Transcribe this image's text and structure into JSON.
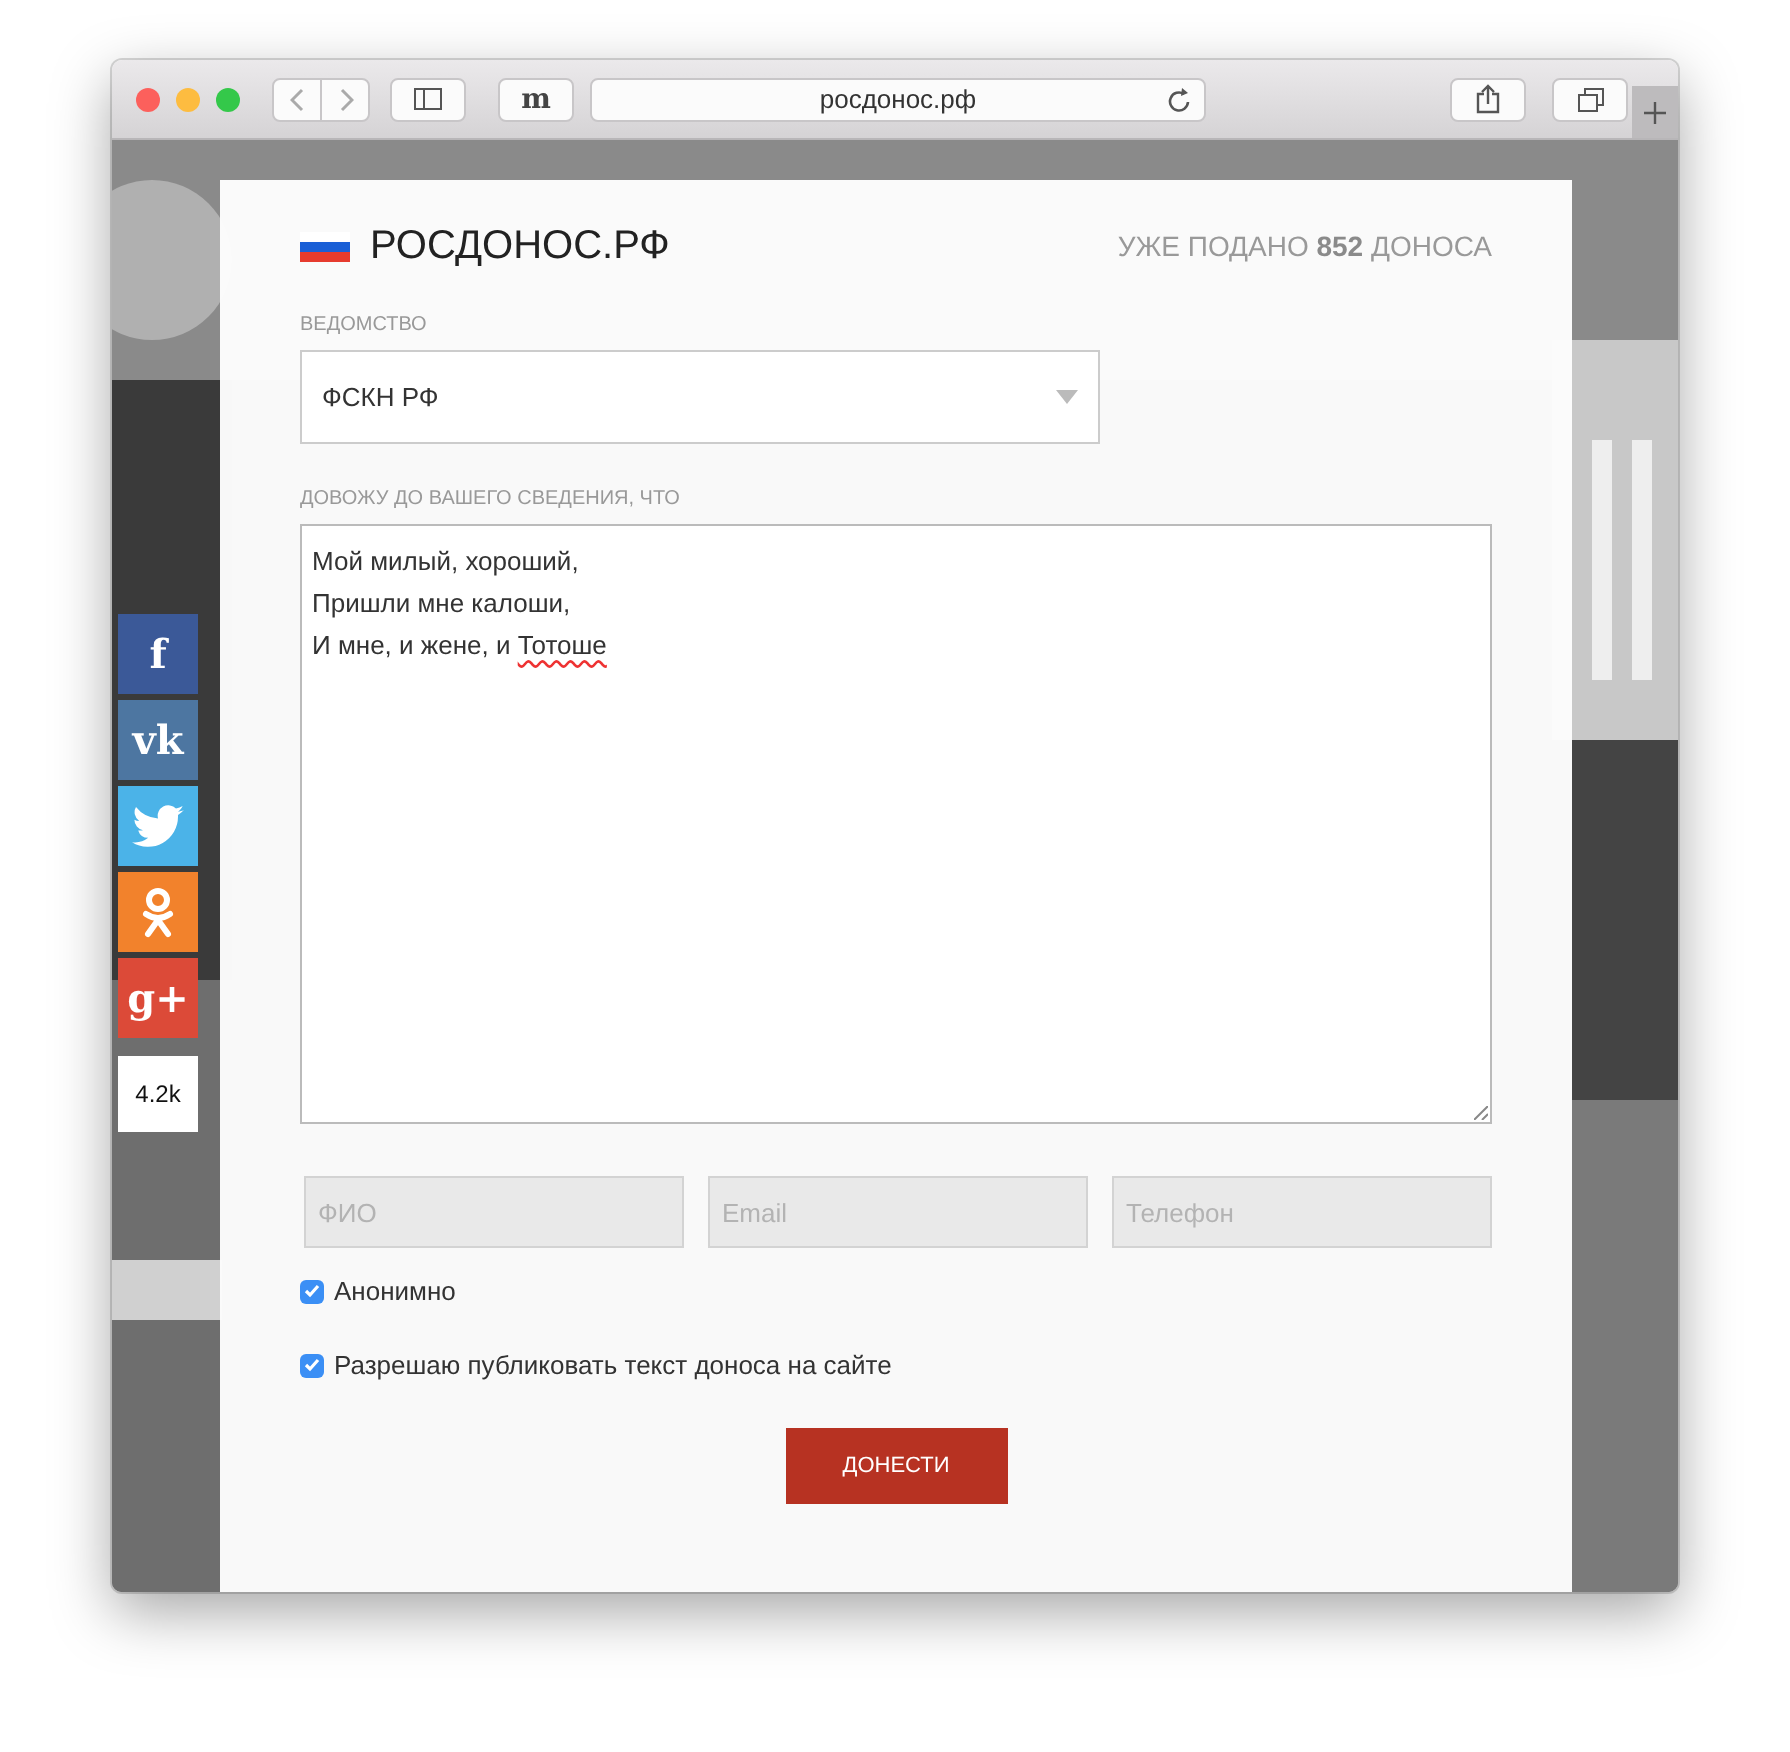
{
  "browser": {
    "url": "росдонос.рф",
    "extension_button": "m"
  },
  "social": {
    "items": [
      {
        "kind": "letter",
        "glyph": "f",
        "color": "#3b5998"
      },
      {
        "kind": "letter",
        "glyph": "vk",
        "color": "#4d76a1"
      },
      {
        "kind": "bird",
        "color": "#4bb3e8"
      },
      {
        "kind": "figure",
        "color": "#f2822c"
      },
      {
        "kind": "letter",
        "glyph": "g+",
        "color": "#dc4a38"
      }
    ],
    "share_count": "4.2k"
  },
  "site": {
    "title": "РОСДОНОС.РФ",
    "counter": "УЖЕ ПОДАНО **852** ДОНОСА"
  },
  "form": {
    "agency": {
      "label": "ВЕДОМСТВО",
      "value": "ФСКН РФ"
    },
    "message": {
      "label": "ДОВОЖУ ДО ВАШЕГО СВЕДЕНИЯ, ЧТО",
      "lines": [
        [
          {
            "text": "Мой милый, хороший,",
            "misspelled": false
          }
        ],
        [
          {
            "text": "Пришли мне калоши,",
            "misspelled": false
          }
        ],
        [
          {
            "text": "И мне, и жене, и ",
            "misspelled": false
          },
          {
            "text": "Тотоше",
            "misspelled": true
          }
        ]
      ]
    },
    "fields": [
      {
        "placeholder": "ФИО",
        "disabled": true
      },
      {
        "placeholder": "Email",
        "disabled": true
      },
      {
        "placeholder": "Телефон",
        "disabled": true
      }
    ],
    "checkboxes": [
      {
        "label": "Анонимно",
        "checked": true
      },
      {
        "label": "Разрешаю публиковать текст доноса на сайте",
        "checked": true
      }
    ],
    "submit": "ДОНЕСТИ"
  }
}
